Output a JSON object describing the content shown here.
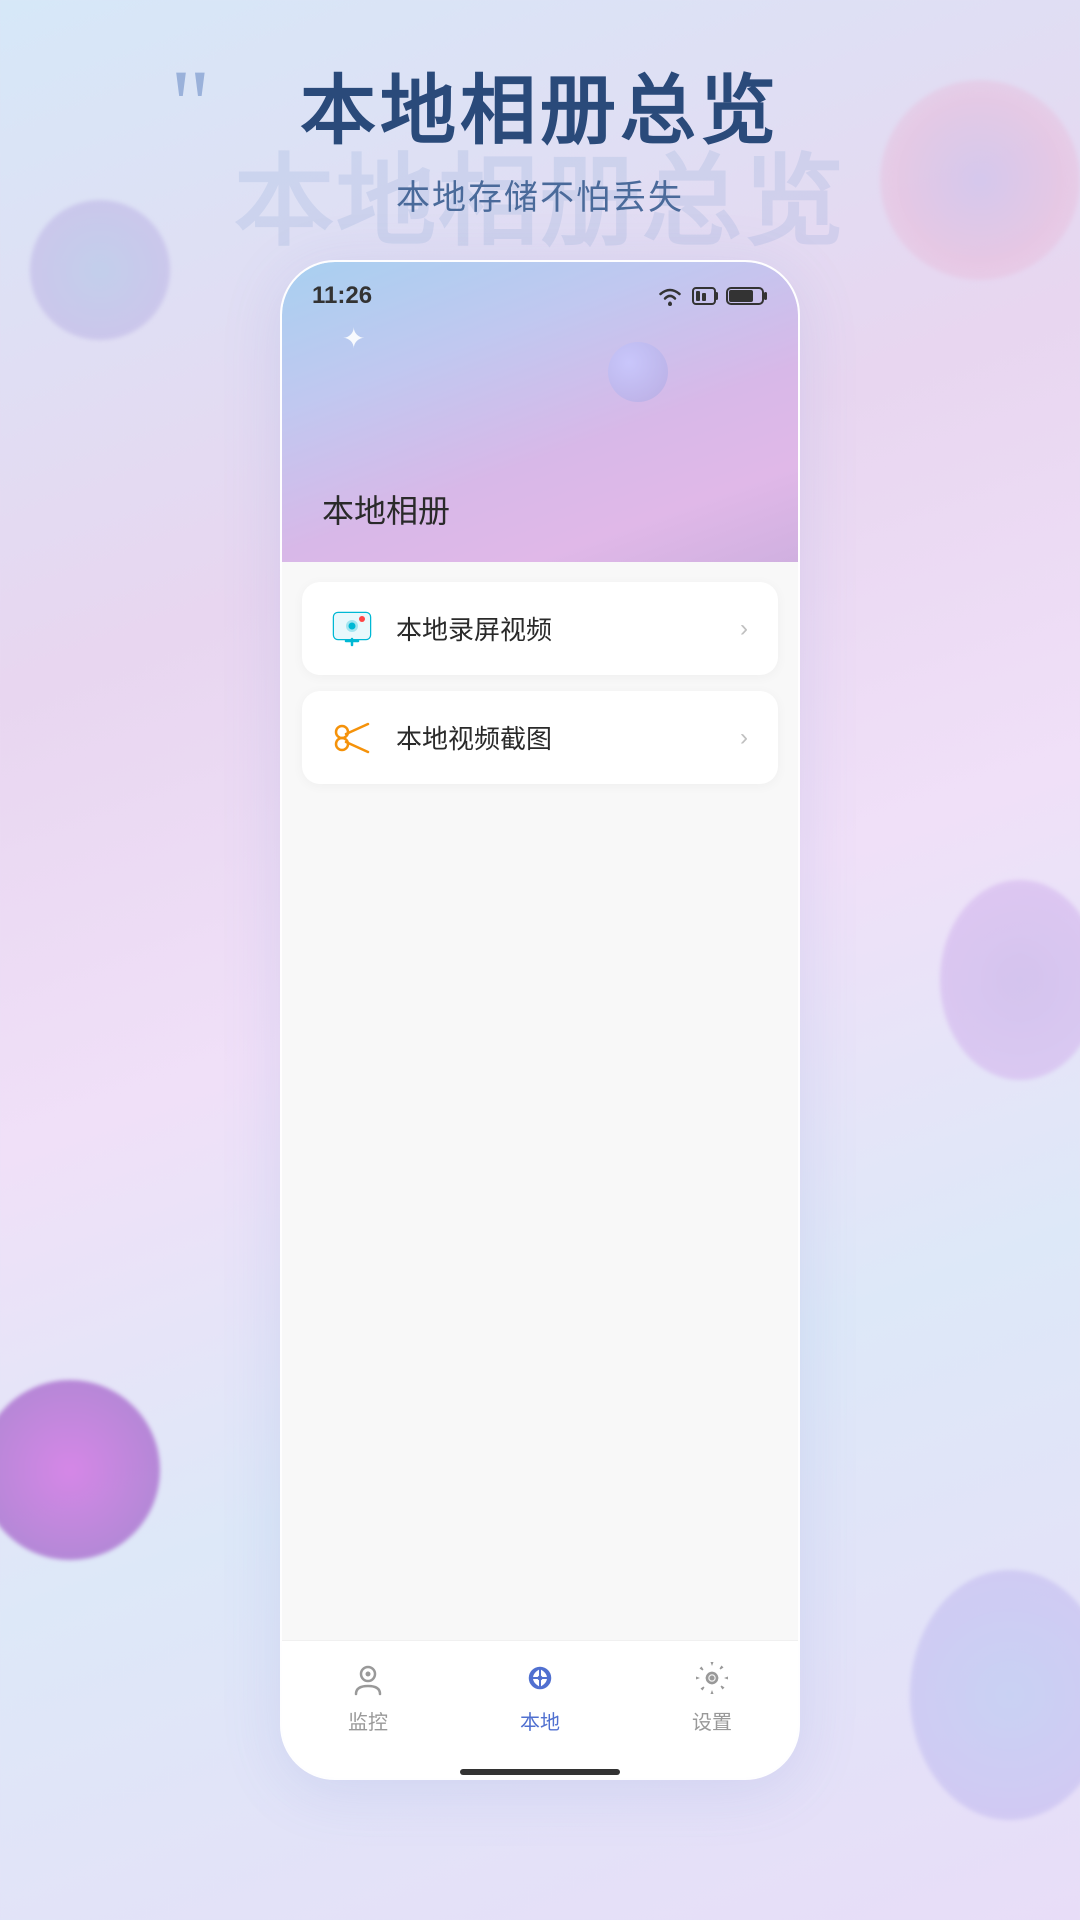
{
  "background": {
    "colors": [
      "#d6e8f8",
      "#e8d6f0",
      "#f0e0f8",
      "#dde8f8"
    ]
  },
  "page_header": {
    "title": "本地相册总览",
    "subtitle": "本地存储不怕丢失",
    "watermark": "本地相册总览",
    "quote": "““"
  },
  "phone": {
    "status_bar": {
      "time": "11:26"
    },
    "header": {
      "album_title": "本地相册"
    },
    "menu_items": [
      {
        "id": "screen-record",
        "icon": "screen-record-icon",
        "label": "本地录屏视频",
        "has_arrow": true
      },
      {
        "id": "video-screenshot",
        "icon": "scissors-icon",
        "label": "本地视频截图",
        "has_arrow": true
      }
    ],
    "bottom_nav": {
      "items": [
        {
          "id": "monitor",
          "label": "监控",
          "active": false,
          "icon": "monitor-icon"
        },
        {
          "id": "local",
          "label": "本地",
          "active": true,
          "icon": "local-icon"
        },
        {
          "id": "settings",
          "label": "设置",
          "active": false,
          "icon": "settings-icon"
        }
      ]
    }
  }
}
